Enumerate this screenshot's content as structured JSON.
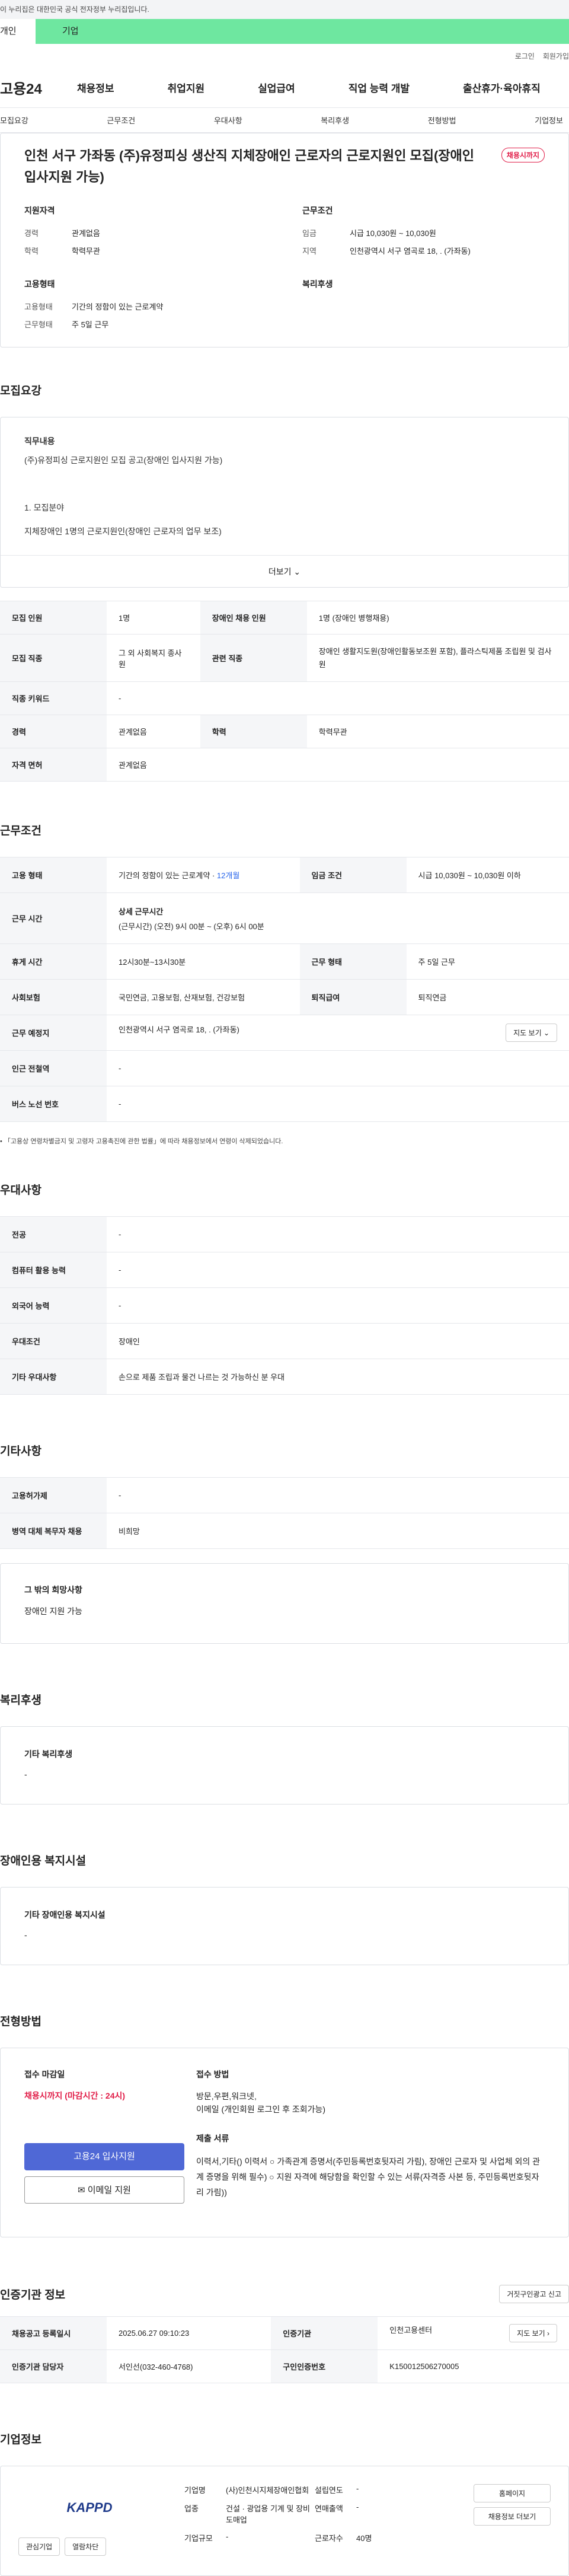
{
  "gov_banner": "이 누리집은 대한민국 공식 전자정부 누리집입니다.",
  "top_tabs": [
    "개인",
    "기업"
  ],
  "util": [
    "로그인",
    "회원가입"
  ],
  "logo": "고용24",
  "gnb": [
    "채용정보",
    "취업지원",
    "실업급여",
    "직업 능력 개발",
    "출산휴가·육아휴직"
  ],
  "subnav": [
    "모집요강",
    "근무조건",
    "우대사항",
    "복리후생",
    "전형방법",
    "기업정보"
  ],
  "summary": {
    "title": "인천 서구 가좌동 (주)유정피싱 생산직 지체장애인 근로자의 근로지원인 모집(장애인 입사지원 가능)",
    "badge": "채용시까지",
    "qual_h": "지원자격",
    "career_k": "경력",
    "career_v": "관계없음",
    "edu_k": "학력",
    "edu_v": "학력무관",
    "emp_h": "고용형태",
    "type_k": "고용형태",
    "type_v": "기간의 정함이 있는 근로계약",
    "week_k": "근무형태",
    "week_v": "주 5일 근무",
    "cond_h": "근무조건",
    "wage_k": "임금",
    "wage_v": "시급 10,030원 ~ 10,030원",
    "area_k": "지역",
    "area_v": "인천광역시 서구 염곡로 18, . (가좌동)",
    "welfare_h": "복리후생"
  },
  "recruit": {
    "title": "모집요강",
    "duty_h": "직무내용",
    "duty_line": "(주)유정피싱 근로지원인 모집 공고(장애인 입사지원 가능)",
    "item1": "1. 모집분야",
    "item1_desc": "지체장애인 1명의 근로지원인(장애인 근로자의 업무 보조)",
    "more": "더보기 ⌄",
    "rows": [
      {
        "k1": "모집 인원",
        "v1": "1명",
        "k2": "장애인 채용 인원",
        "v2": "1명 (장애인 병행채용)"
      },
      {
        "k1": "모집 직종",
        "v1": "그 외 사회복지 종사원",
        "k2": "관련 직종",
        "v2": "장애인 생활지도원(장애인활동보조원 포함), 플라스틱제품 조립원 및 검사원"
      },
      {
        "k1": "직종 키워드",
        "v1": "-"
      },
      {
        "k1": "경력",
        "v1": "관계없음",
        "k2": "학력",
        "v2": "학력무관"
      },
      {
        "k1": "자격 면허",
        "v1": "관계없음"
      }
    ]
  },
  "cond": {
    "title": "근무조건",
    "type_k": "고용 형태",
    "type_v": "기간의 정함이 있는 근로계약 · ",
    "type_v2": "12개월",
    "wage_k": "임금 조건",
    "wage_v": "시급 10,030원 ~ 10,030원 이하",
    "time_k": "근무 시간",
    "time_h": "상세 근무시간",
    "time_v": "(근무시간) (오전) 9시 00분 ~ (오후) 6시 00분",
    "rest_k": "휴게 시간",
    "rest_v": "12시30분~13시30분",
    "form_k": "근무 형태",
    "form_v": "주 5일 근무",
    "ins_k": "사회보험",
    "ins_v": "국민연금, 고용보험, 산재보험, 건강보험",
    "sev_k": "퇴직급여",
    "sev_v": "퇴직연금",
    "place_k": "근무 예정지",
    "place_v": "인천광역시 서구 염곡로 18, . (가좌동)",
    "map": "지도 보기 ⌄",
    "sub_k": "인근 전철역",
    "sub_v": "-",
    "bus_k": "버스 노선 번호",
    "bus_v": "-",
    "note": "• 「고용상 연령차별금지 및 고령자 고용촉진에 관한 법률」에 따라 채용정보에서 연령이 삭제되었습니다."
  },
  "pref": {
    "title": "우대사항",
    "rows": [
      {
        "k": "전공",
        "v": "-"
      },
      {
        "k": "컴퓨터 활용 능력",
        "v": "-"
      },
      {
        "k": "외국어 능력",
        "v": "-"
      },
      {
        "k": "우대조건",
        "v": "장애인"
      },
      {
        "k": "기타 우대사항",
        "v": "손으로 제품 조립과 물건 나르는 것 가능하신 분 우대"
      }
    ]
  },
  "etc": {
    "title": "기타사항",
    "rows": [
      {
        "k": "고용허가제",
        "v": "-"
      },
      {
        "k": "병역 대체 복무자 채용",
        "v": "비희망"
      }
    ],
    "wish_h": "그 밖의 희망사항",
    "wish_v": "장애인 지원 가능"
  },
  "welfare": {
    "title": "복리후생",
    "h": "기타 복리후생",
    "v": "-"
  },
  "facility": {
    "title": "장애인용 복지시설",
    "h": "기타 장애인용 복지시설",
    "v": "-"
  },
  "apply": {
    "title": "전형방법",
    "deadline_h": "접수 마감일",
    "deadline_v": "채용시까지 (마감시간 : 24시)",
    "method_h": "접수 방법",
    "method_v1": "방문,우편,워크넷,",
    "method_v2": "이메일 (개인회원 로그인 후 조회가능)",
    "docs_h": "제출 서류",
    "docs_v": "이력서,기타() 이력서 ○ 가족관계 증명서(주민등록번호뒷자리 가림), 장애인 근로자 및 사업체 외의 관계 증명을 위해 필수) ○ 지원 자격에 해당함을 확인할 수 있는 서류(자격증 사본 등, 주민등록번호뒷자리 가림))",
    "apply_btn": "고용24 입사지원",
    "email_btn": "이메일 지원"
  },
  "cert": {
    "title": "인증기관 정보",
    "report": "거짓구인광고 신고",
    "reg_k": "채용공고 등록일시",
    "reg_v": "2025.06.27 09:10:23",
    "org_k": "인증기관",
    "org_v": "인천고용센터",
    "map": "지도 보기 ›",
    "mgr_k": "인증기관 담당자",
    "mgr_v": "서인선(032-460-4768)",
    "no_k": "구인인증번호",
    "no_v": "K150012506270005"
  },
  "corp": {
    "title": "기업정보",
    "logo_text": "KAPPD",
    "like": "관심기업",
    "block": "열람차단",
    "name_k": "기업명",
    "name_v": "(사)인천시지체장애인협회",
    "year_k": "설립연도",
    "year_v": "-",
    "ind_k": "업종",
    "ind_v": "건설 · 광업용 기계 및 장비 도매업",
    "sales_k": "연매출액",
    "sales_v": "-",
    "emp_k": "근로자수",
    "emp_v": "40명",
    "size_k": "기업규모",
    "size_v": "-",
    "home": "홈페이지",
    "jobs": "채용정보 더보기"
  }
}
